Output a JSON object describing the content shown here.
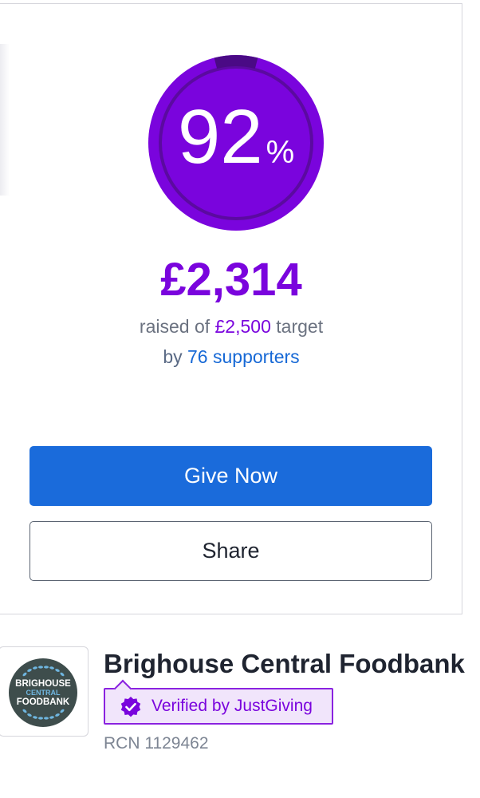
{
  "campaign": {
    "progress_percent": 92,
    "progress_number": "92",
    "progress_sign": "%",
    "raised_amount": "£2,314",
    "raised_prefix": "raised of",
    "target_amount": "£2,500",
    "target_suffix": "target",
    "supporters_prefix": "by",
    "supporters_link": "76 supporters"
  },
  "actions": {
    "give_now_label": "Give Now",
    "share_label": "Share"
  },
  "charity": {
    "name": "Brighouse Central Foodbank",
    "verified_label": "Verified by JustGiving",
    "rcn": "RCN 1129462",
    "logo_text": [
      "BRIGHOUSE",
      "CENTRAL",
      "FOODBANK"
    ],
    "logo_icon": "wreath-logo"
  },
  "colors": {
    "brand_purple": "#7a04dd",
    "button_blue": "#1a6bdb",
    "link_blue": "#1769d6"
  }
}
